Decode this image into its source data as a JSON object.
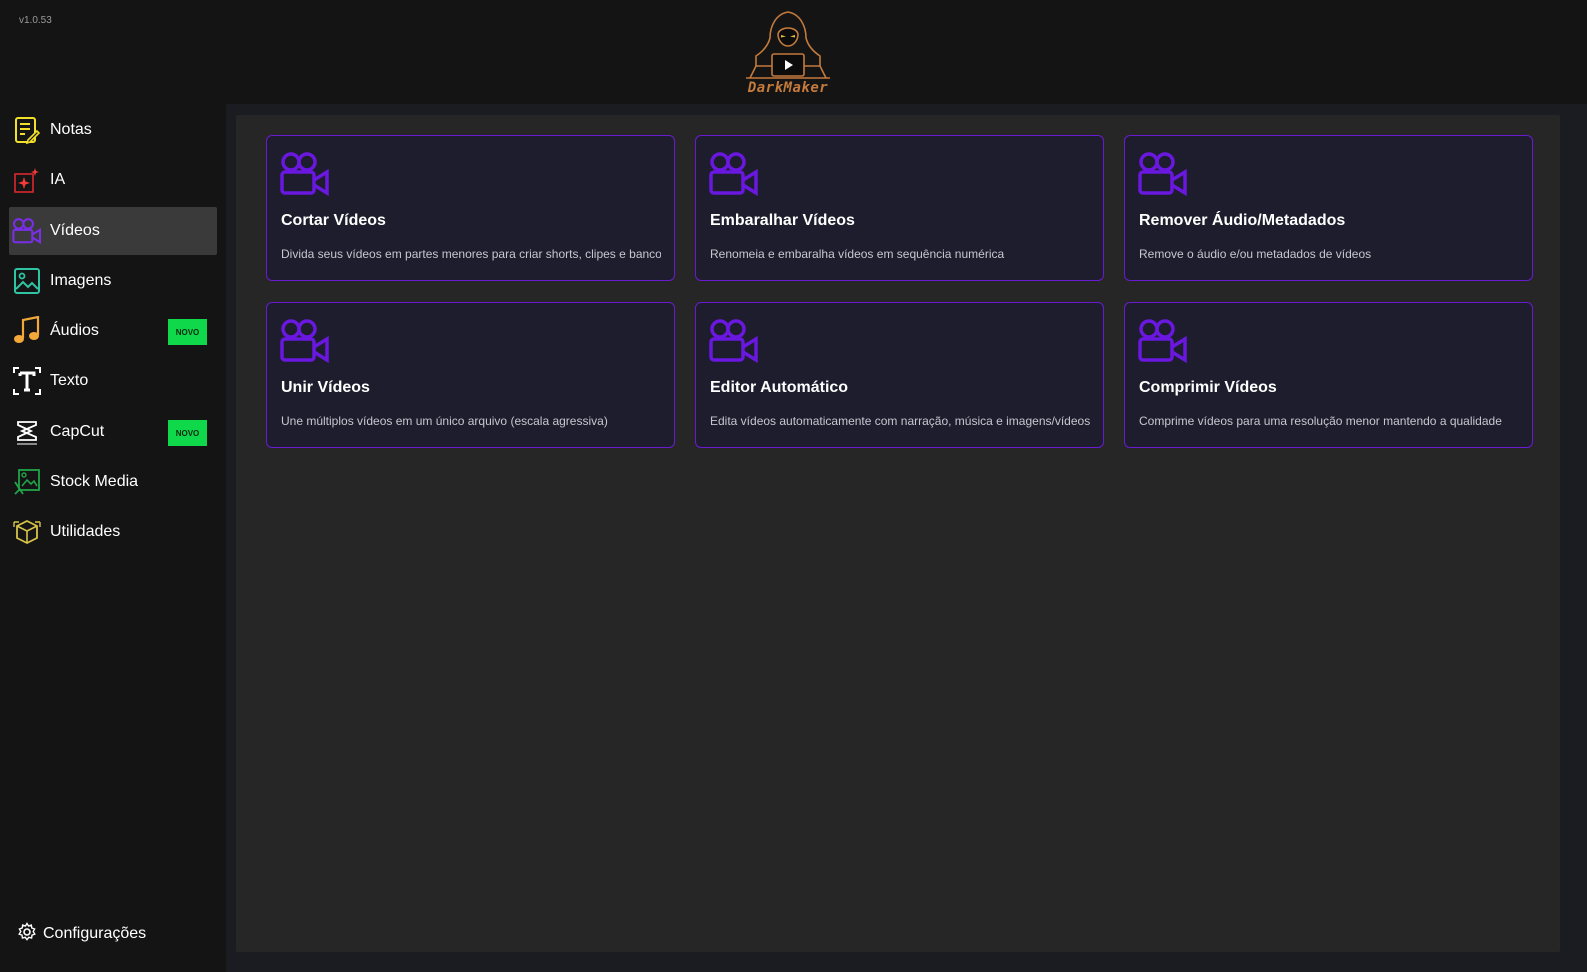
{
  "app": {
    "version": "v1.0.53",
    "logo_text": "DarkMaker"
  },
  "sidebar": {
    "items": [
      {
        "label": "Notas",
        "icon": "notes-icon"
      },
      {
        "label": "IA",
        "icon": "ai-sparkle-icon"
      },
      {
        "label": "Vídeos",
        "icon": "video-camera-icon",
        "active": true
      },
      {
        "label": "Imagens",
        "icon": "image-icon"
      },
      {
        "label": "Áudios",
        "icon": "music-note-icon",
        "badge": "NOVO"
      },
      {
        "label": "Texto",
        "icon": "text-icon"
      },
      {
        "label": "CapCut",
        "icon": "capcut-icon",
        "badge": "NOVO"
      },
      {
        "label": "Stock Media",
        "icon": "stock-media-icon"
      },
      {
        "label": "Utilidades",
        "icon": "utilities-icon"
      }
    ],
    "settings_label": "Configurações",
    "settings_icon": "gear-icon"
  },
  "cards": [
    {
      "title": "Cortar Vídeos",
      "description": "Divida seus vídeos em partes menores para criar shorts, clipes e banco de vídeos",
      "icon": "video-camera-icon"
    },
    {
      "title": "Embaralhar Vídeos",
      "description": "Renomeia e embaralha vídeos em sequência numérica",
      "icon": "video-camera-icon"
    },
    {
      "title": "Remover Áudio/Metadados",
      "description": "Remove o áudio e/ou metadados de vídeos",
      "icon": "video-camera-icon"
    },
    {
      "title": "Unir Vídeos",
      "description": "Une múltiplos vídeos em um único arquivo (escala agressiva)",
      "icon": "video-camera-icon"
    },
    {
      "title": "Editor Automático",
      "description": "Edita vídeos automaticamente com narração, música e imagens/vídeos",
      "icon": "video-camera-icon"
    },
    {
      "title": "Comprimir Vídeos",
      "description": "Comprime vídeos para uma resolução menor mantendo a qualidade",
      "icon": "video-camera-icon"
    }
  ],
  "colors": {
    "accent": "#6a1bd1",
    "badge": "#0fd84a",
    "active_bg": "#3a3a3a",
    "card_bg": "#1d1d2d"
  }
}
